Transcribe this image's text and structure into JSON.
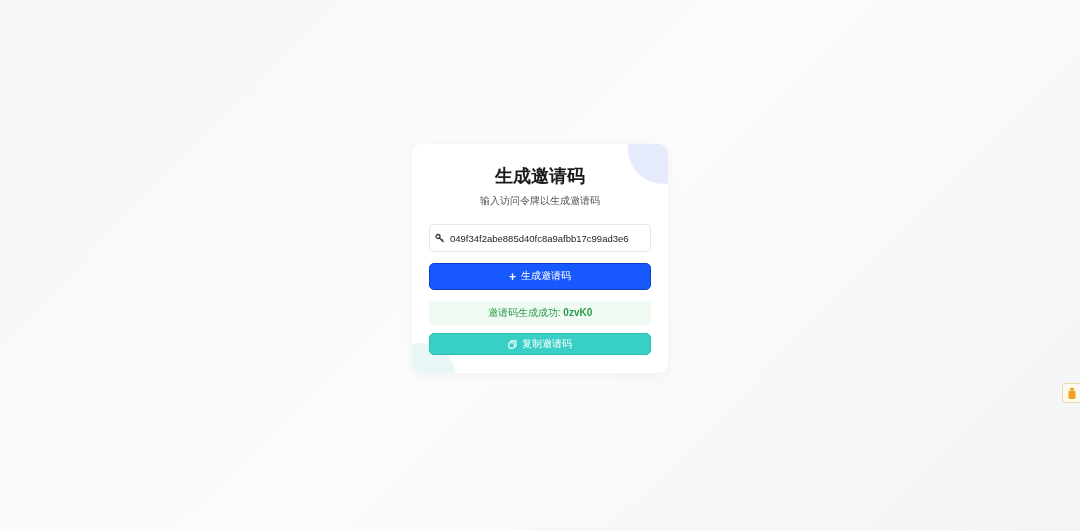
{
  "card": {
    "title": "生成邀请码",
    "subtitle": "输入访问令牌以生成邀请码"
  },
  "token_field": {
    "value": "049f34f2abe885d40fc8a9afbb17c99ad3e6"
  },
  "generate_button": {
    "icon": "+",
    "label": "生成邀请码"
  },
  "result": {
    "message": "邀请码生成成功: **0zvK0**"
  },
  "copy_button": {
    "label": "复制邀请码"
  }
}
